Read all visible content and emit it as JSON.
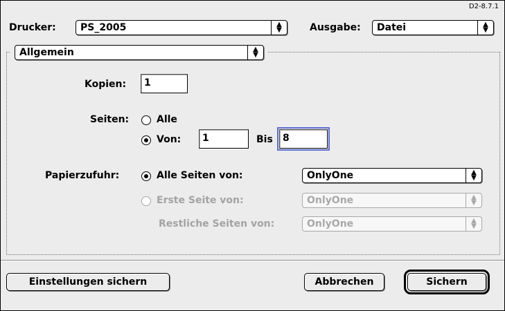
{
  "version": "D2-8.7.1",
  "printer": {
    "label": "Drucker:",
    "value": "PS_2005"
  },
  "output": {
    "label": "Ausgabe:",
    "value": "Datei"
  },
  "panel": {
    "value": "Allgemein"
  },
  "copies": {
    "label": "Kopien:",
    "value": "1"
  },
  "pages": {
    "label": "Seiten:",
    "all_label": "Alle",
    "all_selected": false,
    "from_label": "Von:",
    "from_selected": true,
    "from_value": "1",
    "to_label": "Bis",
    "to_value": "8"
  },
  "paper_source": {
    "label": "Papierzufuhr:",
    "all_pages_label": "Alle Seiten von:",
    "all_pages_selected": true,
    "all_pages_value": "OnlyOne",
    "first_page_label": "Erste Seite von:",
    "first_page_value": "OnlyOne",
    "remaining_label": "Restliche Seiten von:",
    "remaining_value": "OnlyOne"
  },
  "buttons": {
    "save_settings": "Einstellungen sichern",
    "cancel": "Abbrechen",
    "save": "Sichern"
  },
  "icons": {
    "popup_arrows": "updown-arrows-icon"
  }
}
